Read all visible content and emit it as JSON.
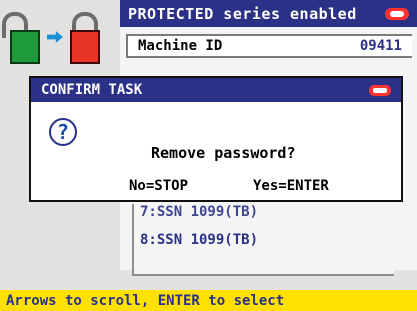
{
  "header": {
    "title": "PROTECTED series enabled"
  },
  "machine": {
    "label": "Machine ID",
    "value": "09411"
  },
  "dialog": {
    "title": "CONFIRM TASK",
    "message": "Remove password?",
    "option_no": "No=STOP",
    "option_yes": "Yes=ENTER"
  },
  "list": {
    "items": [
      {
        "label": "7:SSN 1099(TB)"
      },
      {
        "label": "8:SSN 1099(TB)"
      }
    ]
  },
  "status": {
    "text": "Arrows to scroll, ENTER to select"
  },
  "icons": {
    "lock_open": "open-lock-icon",
    "lock_closed": "closed-lock-icon",
    "arrow": "arrow-right-icon",
    "brand": "brand-logo-icon",
    "question": "question-icon"
  },
  "colors": {
    "header_bg": "#2a3186",
    "status_bg": "#ffe100",
    "accent_red": "#ff3131"
  }
}
